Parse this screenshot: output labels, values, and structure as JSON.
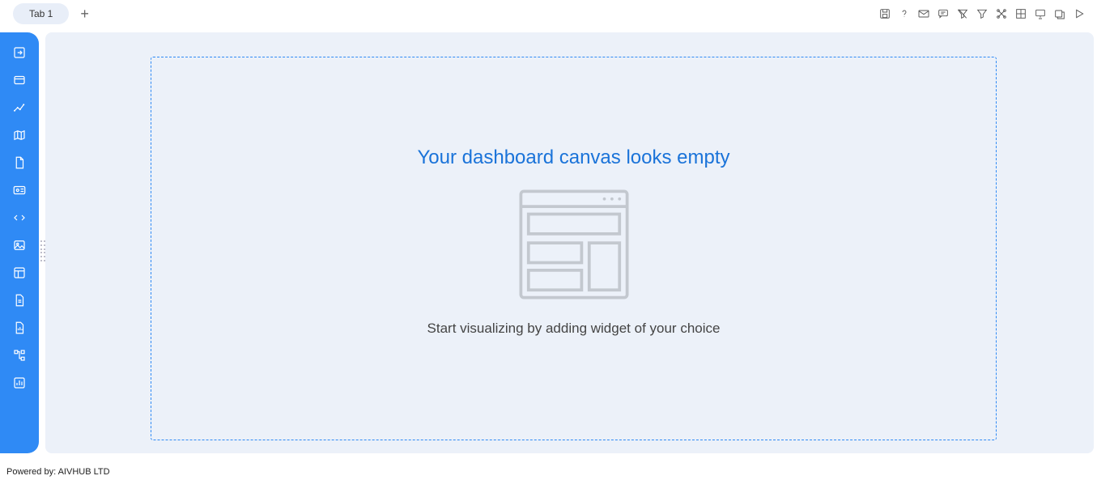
{
  "tabs": {
    "tab1_label": "Tab 1"
  },
  "canvas": {
    "heading": "Your dashboard canvas looks empty",
    "subtext": "Start visualizing by adding widget of your choice"
  },
  "footer": {
    "powered_by": "Powered by: AIVHUB LTD"
  }
}
